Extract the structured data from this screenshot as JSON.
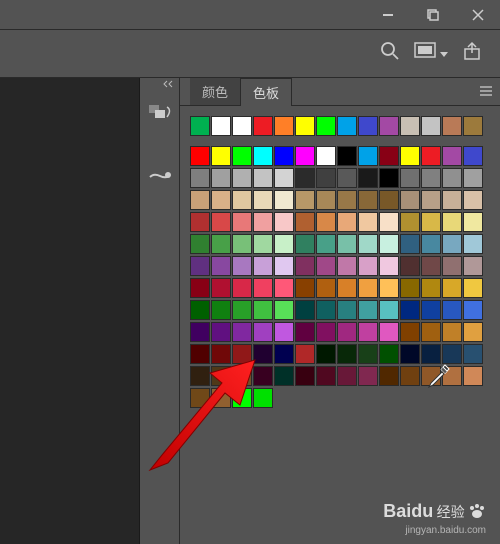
{
  "titlebar": {
    "min": "—",
    "max": "❐",
    "close": "✕"
  },
  "toolbar": {
    "search_icon": "search",
    "screen_icon": "screen",
    "share_icon": "share"
  },
  "tabs": {
    "color_label": "颜色",
    "swatches_label": "色板"
  },
  "panel_strip": {
    "color_icon": "color",
    "brush_icon": "brush"
  },
  "swatches": [
    [
      "#00b050",
      "#ffffff",
      "#ffffff",
      "#ed1c24",
      "#ff7f27",
      "#ffff00",
      "#00ff00",
      "#00a2e8",
      "#3f48cc",
      "#a349a4",
      "#c8bfb3",
      "#c3c3c3",
      "#b97a57",
      "#9c7a3c"
    ],
    [
      "#ff0000",
      "#ffff00",
      "#00ff00",
      "#00ffff",
      "#0000ff",
      "#ff00ff",
      "#ffffff",
      "#000000",
      "#00a2e8",
      "#880015",
      "#ffff00",
      "#ed1c24",
      "#a349a4",
      "#3f48cc"
    ],
    [
      "#7f7f7f",
      "#a0a0a0",
      "#b0b0b0",
      "#c3c3c3",
      "#d3d3d3",
      "#2b2b2b",
      "#404040",
      "#595959",
      "#1a1a1a",
      "#000000",
      "#707070",
      "#808080",
      "#909090",
      "#a0a0a0"
    ],
    [
      "#c8a078",
      "#d8b088",
      "#e0c8a0",
      "#e8d8b8",
      "#f0e8d0",
      "#b89868",
      "#a88858",
      "#987848",
      "#886838",
      "#785828",
      "#a89078",
      "#b8a088",
      "#c8b098",
      "#d8c0a8"
    ],
    [
      "#b03030",
      "#d84848",
      "#e87878",
      "#f0a0a0",
      "#f8c8c8",
      "#b06030",
      "#d88848",
      "#e8a878",
      "#f0c8a0",
      "#f8e0c8",
      "#b09030",
      "#d8b848",
      "#e8d878",
      "#f0e8a0"
    ],
    [
      "#308030",
      "#48a048",
      "#78c078",
      "#a0d8a0",
      "#c8f0c8",
      "#308060",
      "#48a088",
      "#78c0a8",
      "#a0d8c8",
      "#c8f0e0",
      "#306080",
      "#4888a0",
      "#78a8c0",
      "#a0c8d8"
    ],
    [
      "#603080",
      "#8848a0",
      "#a878c0",
      "#c8a0d8",
      "#e0c8f0",
      "#803060",
      "#a04888",
      "#c078a8",
      "#d8a0c8",
      "#f0c8e0",
      "#503030",
      "#704848",
      "#907070",
      "#b09898"
    ],
    [
      "#880015",
      "#b01030",
      "#d82848",
      "#f04060",
      "#ff5878",
      "#884000",
      "#b06010",
      "#d88028",
      "#f0a040",
      "#ffc058",
      "#886800",
      "#b08810",
      "#d8a828",
      "#f0c840"
    ],
    [
      "#006000",
      "#108010",
      "#28a028",
      "#40c040",
      "#58e058",
      "#004040",
      "#106060",
      "#288080",
      "#40a0a0",
      "#58c0c0",
      "#002880",
      "#1040a0",
      "#2858c0",
      "#4070e0"
    ],
    [
      "#400060",
      "#601080",
      "#8028a0",
      "#a040c0",
      "#c058e0",
      "#600040",
      "#801060",
      "#a02880",
      "#c040a0",
      "#e058c0",
      "#804000",
      "#a06010",
      "#c08028",
      "#e0a040"
    ],
    [
      "#500000",
      "#700808",
      "#901818",
      "#200030",
      "#000050",
      "#b02828",
      "#001800",
      "#082808",
      "#184018",
      "#005000",
      "#000828",
      "#082040",
      "#183858",
      "#285070"
    ],
    [
      "#302010",
      "#503818",
      "#705028",
      "#380020",
      "#003028",
      "#380010",
      "#500820",
      "#681838",
      "#802850",
      "#502800",
      "#704010",
      "#905828",
      "#b07040",
      "#d08858"
    ],
    [
      "#704818",
      "#906030",
      "#00ff00",
      "#00e000"
    ]
  ],
  "watermark": {
    "brand": "Baidu",
    "sub": "经验",
    "url": "jingyan.baidu.com"
  }
}
